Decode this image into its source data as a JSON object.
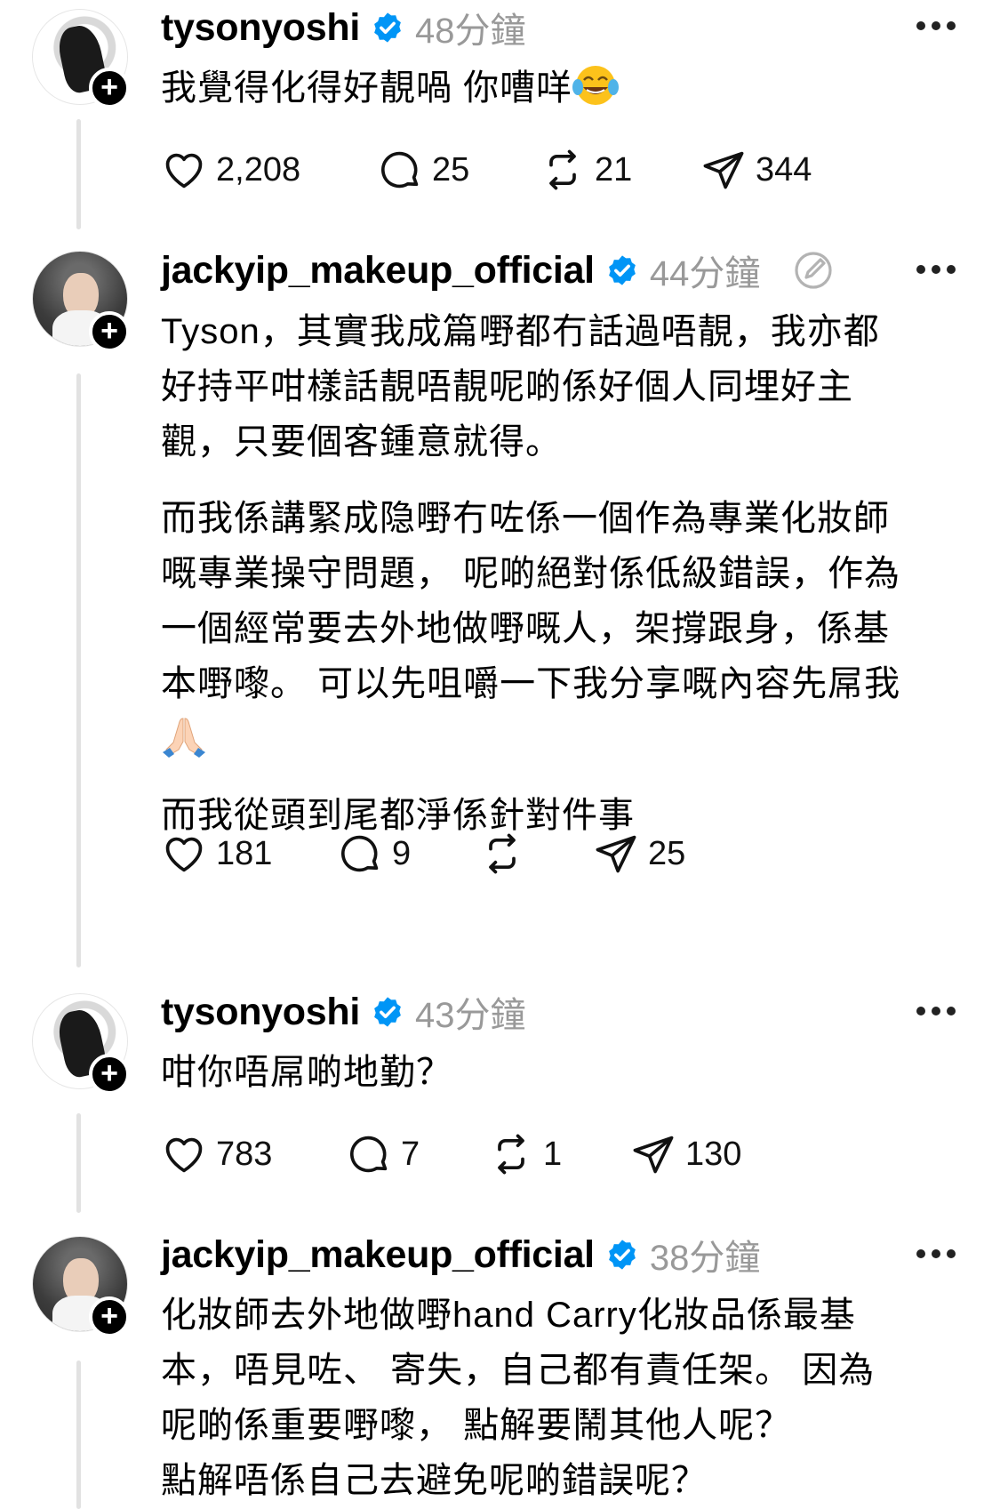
{
  "posts": [
    {
      "username": "tysonyoshi",
      "time": "48分鐘",
      "text": [
        "我覺得化得好靚喎 你嘈咩"
      ],
      "emoji": "face-with-tears-of-joy",
      "likes": "2,208",
      "replies": "25",
      "reposts": "21",
      "shares": "344"
    },
    {
      "username": "jackyip_makeup_official",
      "time": "44分鐘",
      "text": [
        "Tyson，其實我成篇嘢都冇話過唔靚，我亦都",
        "好持平咁樣話靚唔靚呢啲係好個人同埋好主",
        "觀，只要個客鍾意就得。",
        "",
        "而我係講緊成隐嘢冇咗係一個作為專業化妝師",
        "嘅專業操守問題， 呢啲絕對係低級錯誤，作為",
        "一個經常要去外地做嘢嘅人，架撐跟身，係基",
        "本嘢嚟。 可以先咀嚼一下我分享嘅內容先屌我",
        "",
        "",
        "而我從頭到尾都淨係針對件事"
      ],
      "emoji": "folded-hands",
      "likes": "181",
      "replies": "9",
      "reposts": "",
      "shares": "25"
    },
    {
      "username": "tysonyoshi",
      "time": "43分鐘",
      "text": [
        "咁你唔屌啲地勤？"
      ],
      "likes": "783",
      "replies": "7",
      "reposts": "1",
      "shares": "130"
    },
    {
      "username": "jackyip_makeup_official",
      "time": "38分鐘",
      "text": [
        "化妝師去外地做嘢hand Carry化妝品係最基",
        "本，唔見咗、 寄失，自己都有責任架。 因為",
        "呢啲係重要嘢嚟， 點解要鬧其他人呢？",
        "點解唔係自己去避免呢啲錯誤呢？"
      ]
    }
  ],
  "icons": {
    "verified": "verified-badge-icon",
    "more": "more-options-icon",
    "like": "heart-icon",
    "reply": "comment-icon",
    "repost": "repost-icon",
    "share": "send-icon",
    "edit": "edited-icon",
    "follow": "plus-icon"
  },
  "colors": {
    "verified_blue": "#0095f6",
    "secondary_text": "#999999",
    "thread_line": "#e2e2e2"
  }
}
